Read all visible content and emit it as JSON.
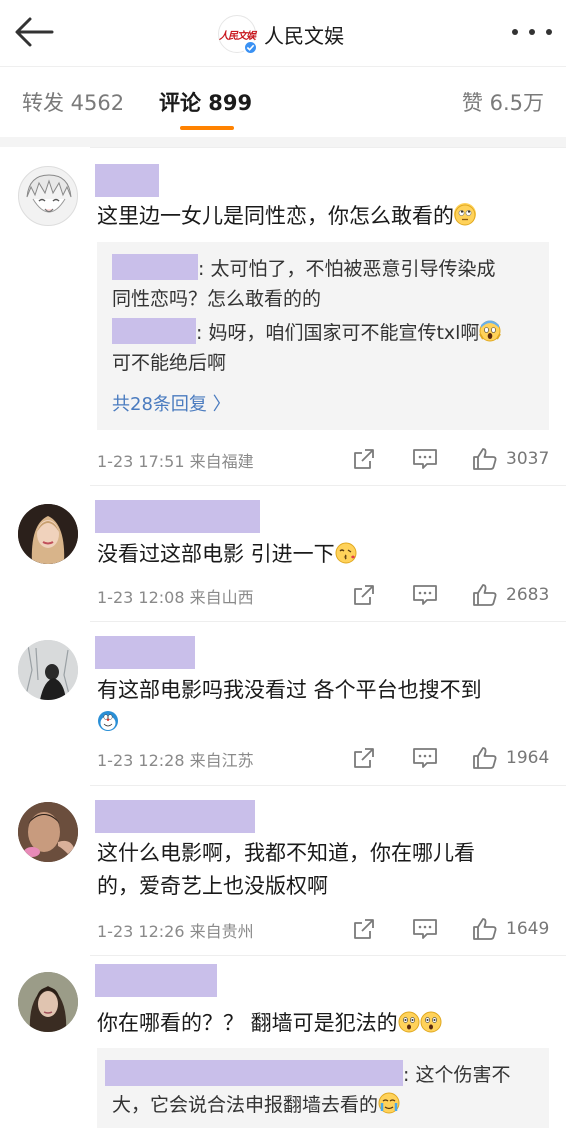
{
  "header": {
    "account_name": "人民文娱",
    "logo_text": "人民文娱",
    "back_icon": "back-arrow-icon",
    "more_icon": "more-icon"
  },
  "tabs": {
    "repost": "转发 4562",
    "comments": "评论 899",
    "likes": "赞 6.5万",
    "accent_color": "#ff8200"
  },
  "comments": [
    {
      "text": "这里边一女儿是同性恋，你怎么敢看的",
      "emoji": "eye-roll-emoji",
      "replies": [
        {
          "line1": ": 太可怕了，不怕被恶意引导传染成",
          "line2": "同性恋吗？怎么敢看的的"
        },
        {
          "line1": ": 妈呀，咱们国家可不能宣传txl啊",
          "line2": "可不能绝后啊",
          "emoji": "scream-emoji"
        }
      ],
      "reply_more": "共28条回复 〉",
      "time_location": "1-23 17:51  来自福建",
      "likes": "3037"
    },
    {
      "text": "没看过这部电影  引进一下",
      "emoji": "kiss-emoji",
      "time_location": "1-23 12:08  来自山西",
      "likes": "2683"
    },
    {
      "text_line1": "有这部电影吗我没看过 各个平台也搜不到",
      "emoji": "doraemon-emoji",
      "time_location": "1-23 12:28  来自江苏",
      "likes": "1964"
    },
    {
      "text_line1": "这什么电影啊，我都不知道，你在哪儿看",
      "text_line2": "的，爱奇艺上也没版权啊",
      "time_location": "1-23 12:26  来自贵州",
      "likes": "1649"
    },
    {
      "text": "你在哪看的？？ 翻墙可是犯法的",
      "emoji": "astonished-emoji",
      "replies": [
        {
          "line1": ": 这个伤害不",
          "line2": "大，它会说合法申报翻墙去看的",
          "emoji": "crying-emoji"
        }
      ]
    }
  ],
  "colors": {
    "redaction": "#c9bfea",
    "link": "#4a7bbf",
    "reply_bg": "#f4f4f4"
  }
}
